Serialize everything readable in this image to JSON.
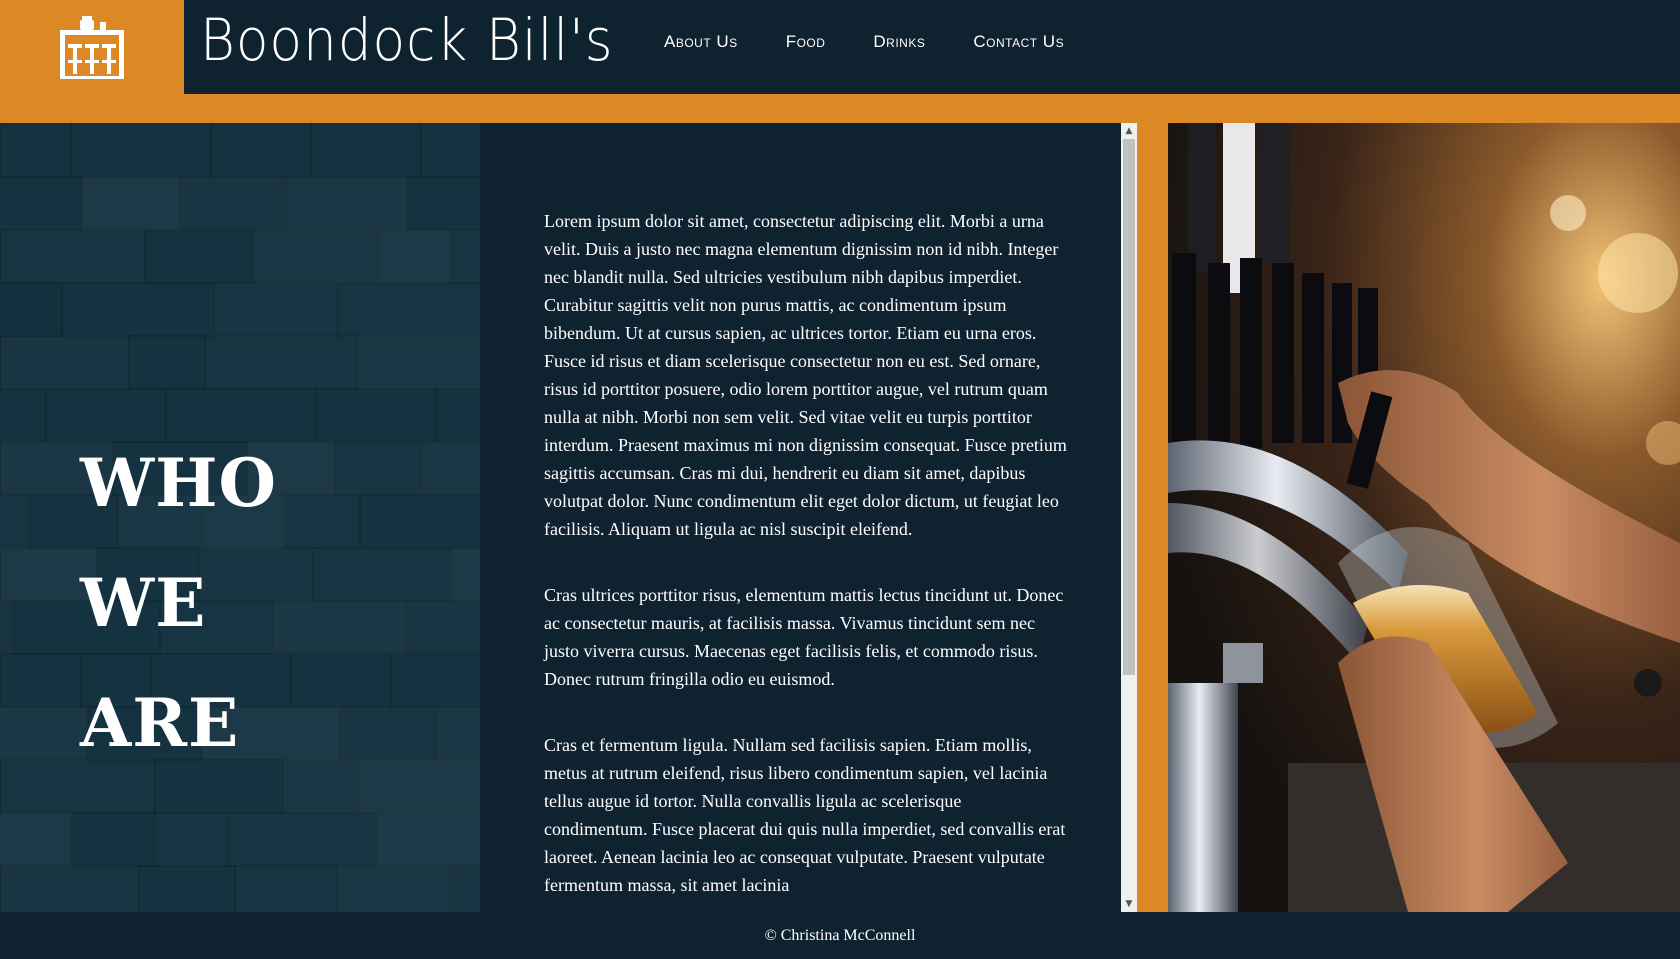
{
  "brand": {
    "name": "Boondock Bill's",
    "logo_icon": "bar-counter-icon",
    "accent_color": "#dc8824",
    "dark_color": "#0e2230"
  },
  "nav": {
    "items": [
      {
        "label": "About Us"
      },
      {
        "label": "Food"
      },
      {
        "label": "Drinks"
      },
      {
        "label": "Contact Us"
      }
    ]
  },
  "hero": {
    "heading_words": [
      "WHO",
      "WE",
      "ARE"
    ]
  },
  "content": {
    "paragraphs": [
      "Lorem ipsum dolor sit amet, consectetur adipiscing elit. Morbi a urna velit. Duis a justo nec magna elementum dignissim non id nibh. Integer nec blandit nulla. Sed ultricies vestibulum nibh dapibus imperdiet. Curabitur sagittis velit non purus mattis, ac condimentum ipsum bibendum. Ut at cursus sapien, ac ultrices tortor. Etiam eu urna eros. Fusce id risus et diam scelerisque consectetur non eu est. Sed ornare, risus id porttitor posuere, odio lorem porttitor augue, vel rutrum quam nulla at nibh. Morbi non sem velit. Sed vitae velit eu turpis porttitor interdum. Praesent maximus mi non dignissim consequat. Fusce pretium sagittis accumsan. Cras mi dui, hendrerit eu diam sit amet, dapibus volutpat dolor. Nunc condimentum elit eget dolor dictum, ut feugiat leo facilisis. Aliquam ut ligula ac nisl suscipit eleifend.",
      "Cras ultrices porttitor risus, elementum mattis lectus tincidunt ut. Donec ac consectetur mauris, at facilisis massa. Vivamus tincidunt sem nec justo viverra cursus. Maecenas eget facilisis felis, et commodo risus. Donec rutrum fringilla odio eu euismod.",
      "Cras et fermentum ligula. Nullam sed facilisis sapien. Etiam mollis, metus at rutrum eleifend, risus libero condimentum sapien, vel lacinia tellus augue id tortor. Nulla convallis ligula ac scelerisque condimentum. Fusce placerat dui quis nulla imperdiet, sed convallis erat laoreet. Aenean lacinia leo ac consequat vulputate. Praesent vulputate fermentum massa, sit amet lacinia"
    ]
  },
  "photo": {
    "icon": "bartender-pouring-beer-photo"
  },
  "footer": {
    "text": "© Christina McConnell"
  }
}
